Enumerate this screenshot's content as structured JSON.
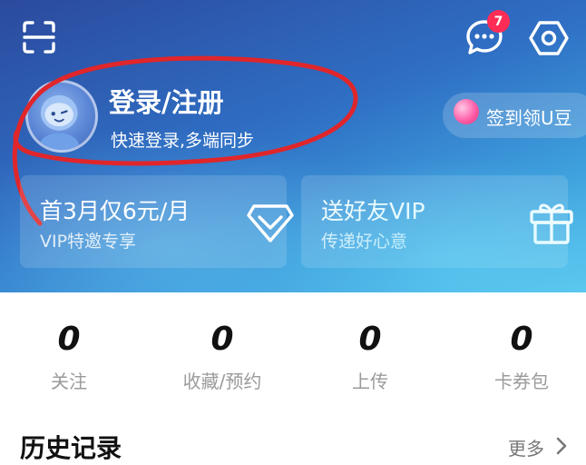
{
  "header": {
    "message_badge": "7"
  },
  "profile": {
    "title": "登录/注册",
    "subtitle": "快速登录,多端同步"
  },
  "signin": {
    "label": "签到领U豆"
  },
  "cards": [
    {
      "title": "首3月仅6元/月",
      "subtitle": "VIP特邀专享"
    },
    {
      "title": "送好友VIP",
      "subtitle": "传递好心意"
    }
  ],
  "stats": [
    {
      "value": "0",
      "label": "关注"
    },
    {
      "value": "0",
      "label": "收藏/预约"
    },
    {
      "value": "0",
      "label": "上传"
    },
    {
      "value": "0",
      "label": "卡券包"
    }
  ],
  "history": {
    "title": "历史记录",
    "more_label": "更多"
  },
  "colors": {
    "badge": "#ff2d55",
    "annotation_stroke": "#e0262b",
    "hero_start": "#2b4a9e",
    "hero_end": "#59c6ee"
  },
  "icons": [
    "scan-icon",
    "message-icon",
    "settings-gear-icon",
    "avatar-icon",
    "sign-in-orb-icon",
    "vip-diamond-icon",
    "gift-icon",
    "chevron-right-icon"
  ]
}
